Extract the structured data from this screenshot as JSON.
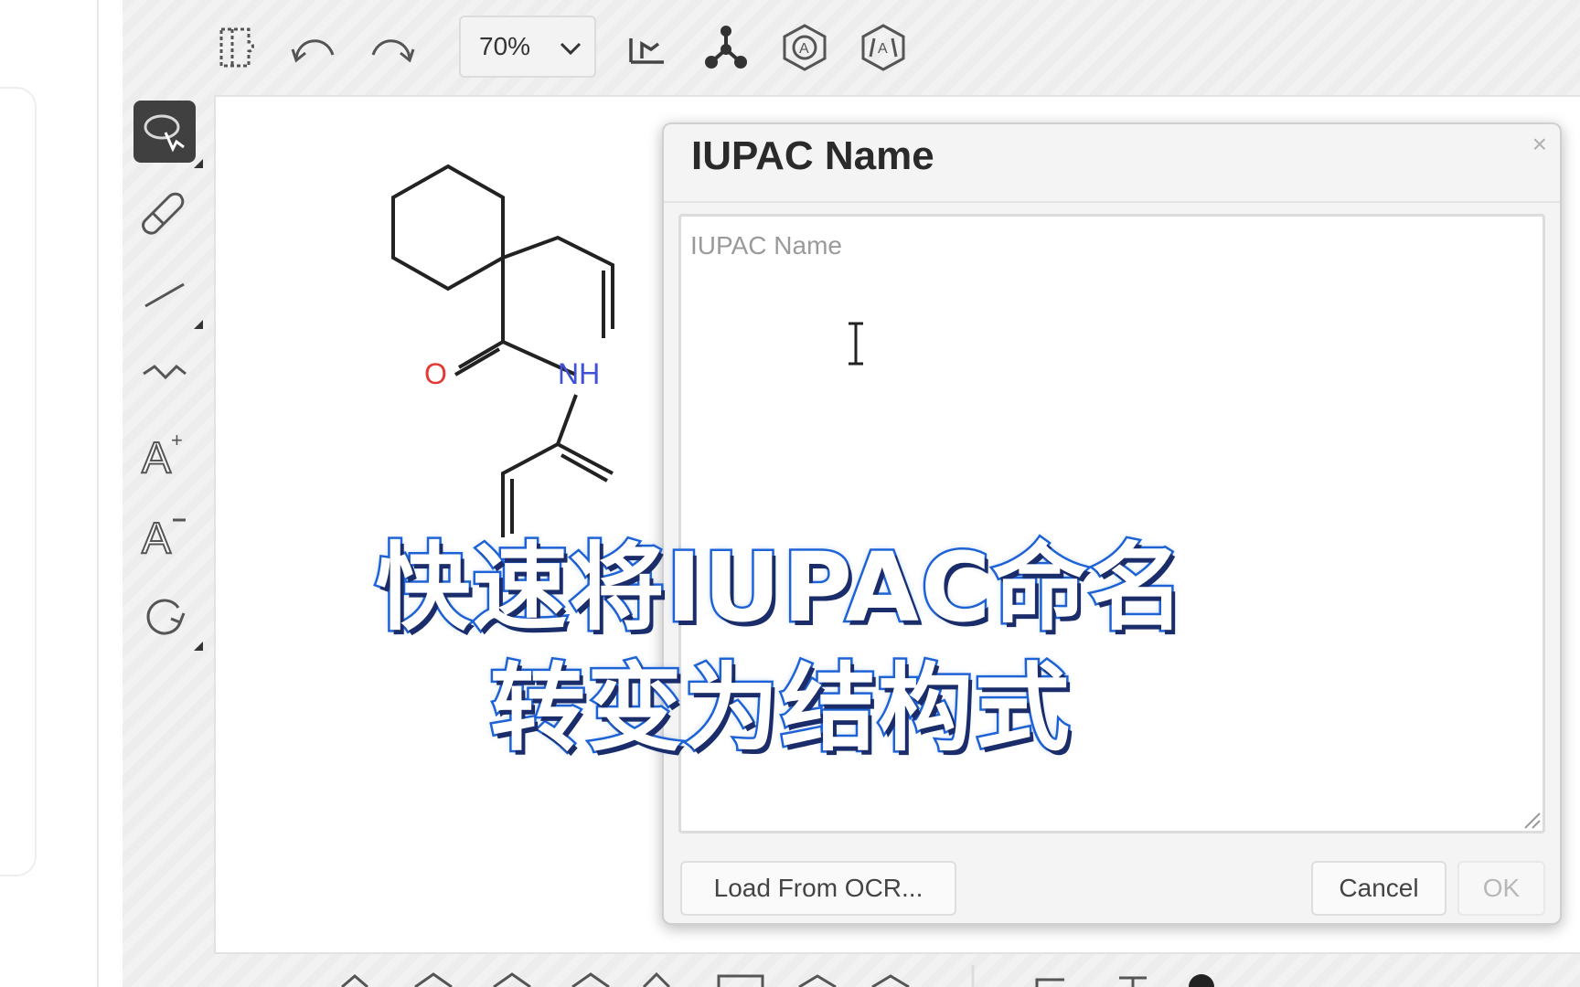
{
  "toolbar": {
    "zoom_value": "70%",
    "icons": [
      "document-icon",
      "undo-icon",
      "redo-icon",
      "zoom-select",
      "clean-2d-icon",
      "clean-3d-icon",
      "aromatize-icon",
      "dearomatize-icon"
    ]
  },
  "left_toolbar": {
    "icons": [
      "lasso-select-icon",
      "eraser-icon",
      "single-bond-icon",
      "chain-icon",
      "charge-plus-icon",
      "charge-minus-icon",
      "rotate-icon"
    ]
  },
  "molecule": {
    "atoms": [
      "O",
      "NH"
    ]
  },
  "dialog": {
    "title": "IUPAC Name",
    "close_label": "×",
    "textarea_placeholder": "IUPAC Name",
    "textarea_value": "",
    "load_ocr_label": "Load From OCR...",
    "cancel_label": "Cancel",
    "ok_label": "OK"
  },
  "caption": {
    "line1": "快速将IUPAC命名",
    "line2": "转变为结构式"
  },
  "colors": {
    "caption_fill": "#ffffff",
    "caption_stroke": "#1e63d6",
    "oxygen": "#e53935",
    "nitrogen": "#3f51d8",
    "active_tool": "#404040"
  }
}
